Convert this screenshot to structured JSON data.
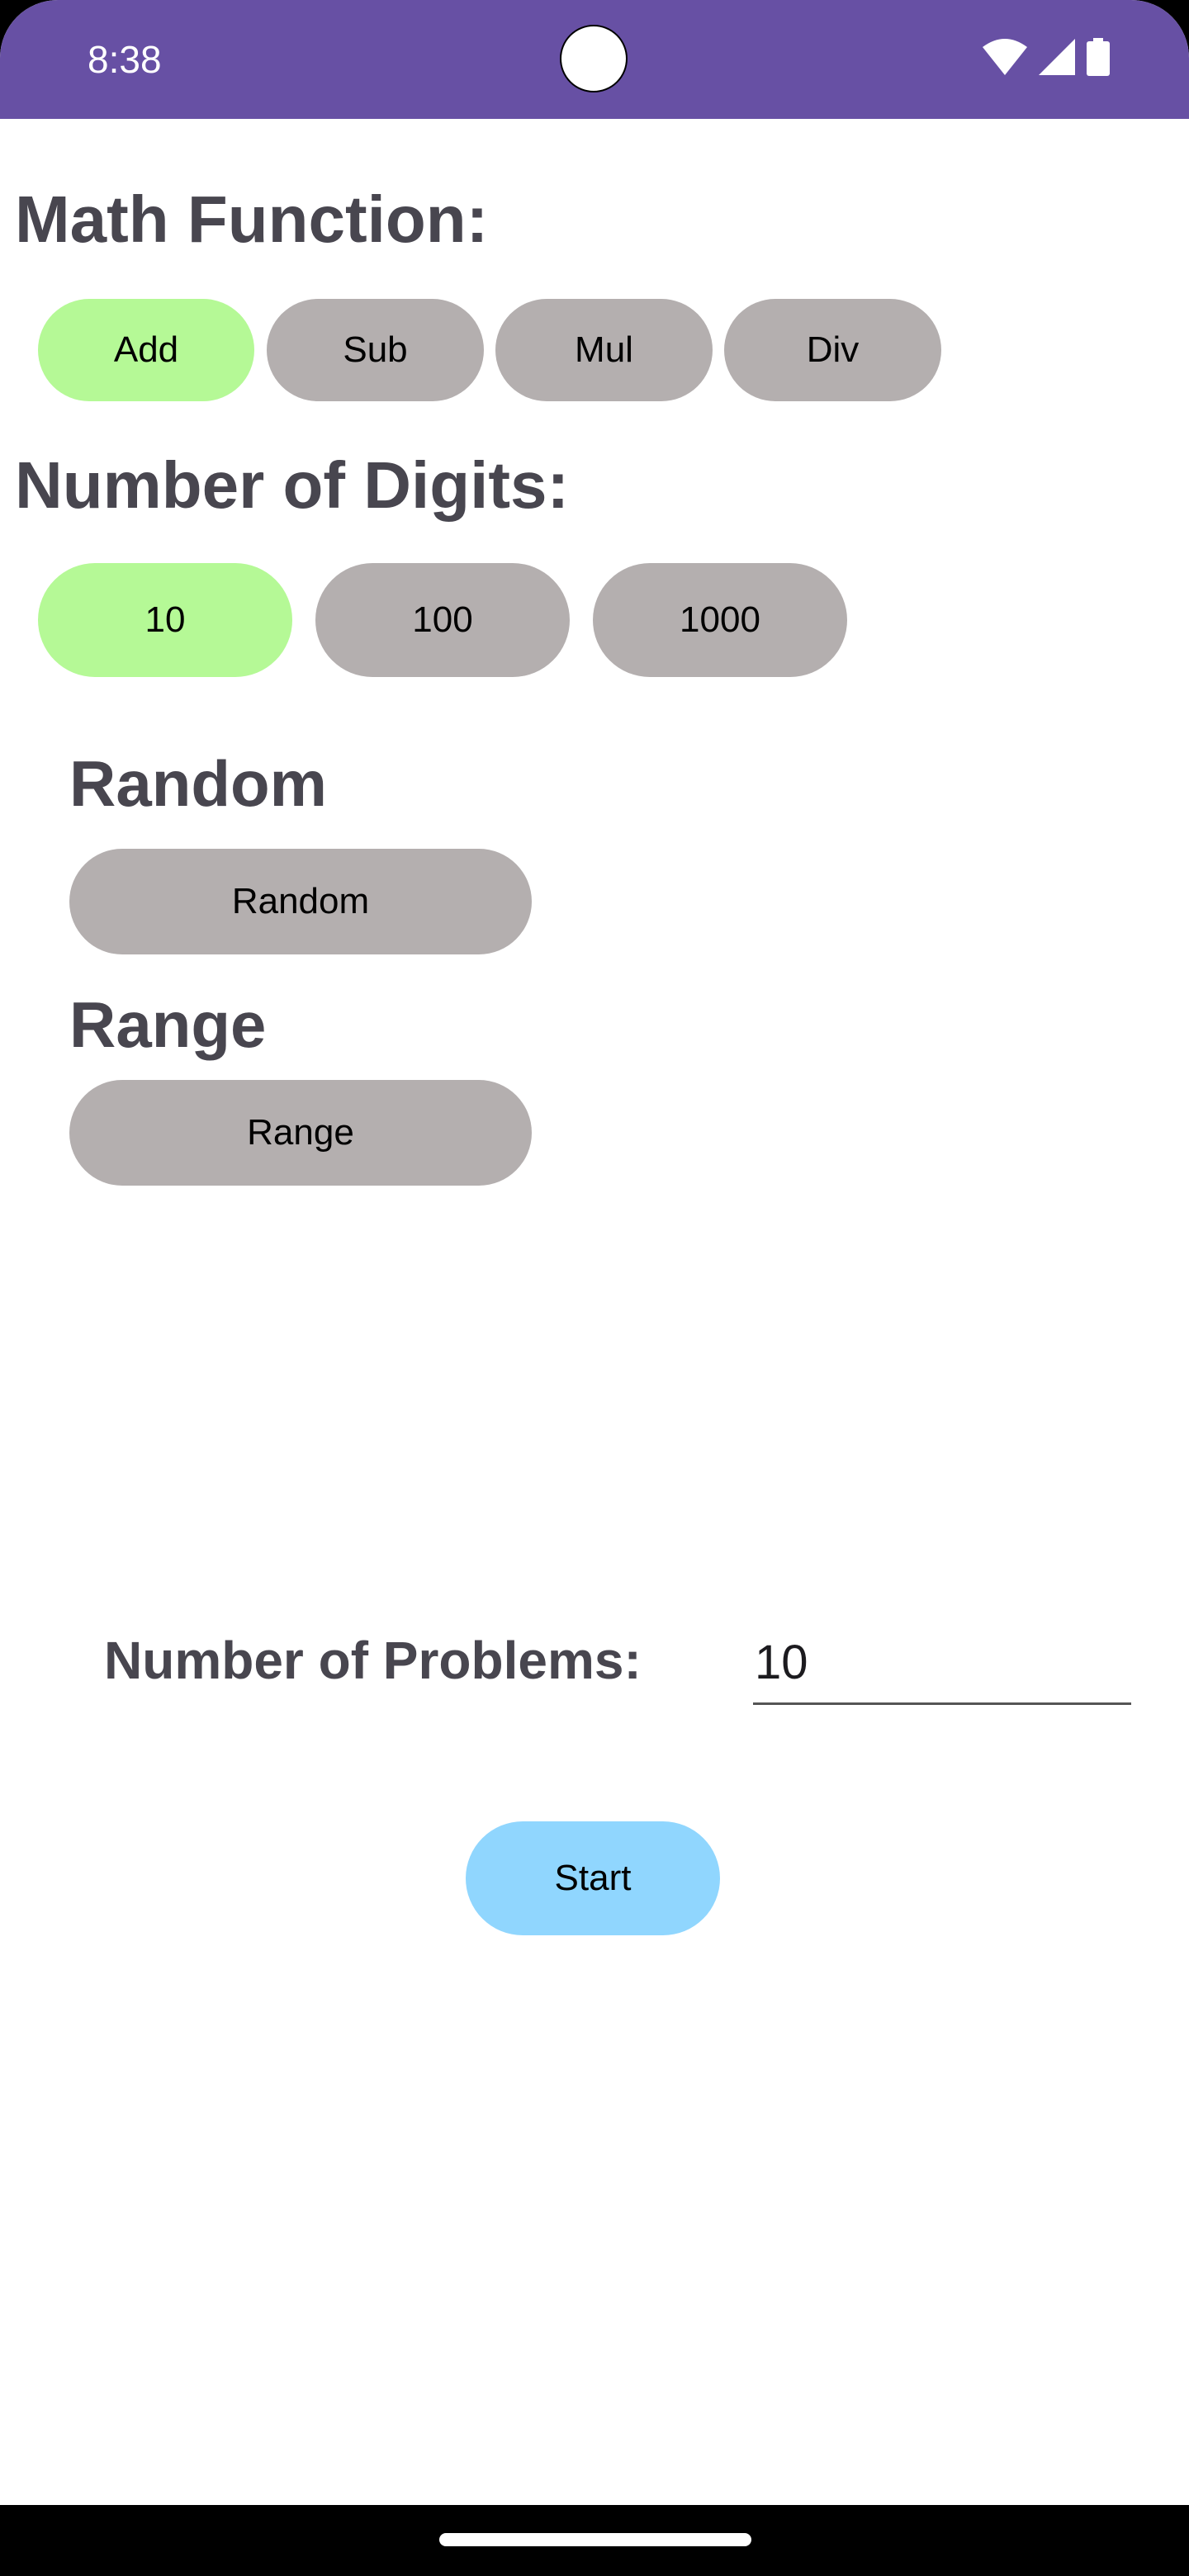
{
  "status_bar": {
    "time": "8:38",
    "icons": [
      "wifi-icon",
      "signal-icon",
      "battery-icon"
    ],
    "color": "#6750a4"
  },
  "math_function": {
    "title": "Math Function:",
    "options": [
      "Add",
      "Sub",
      "Mul",
      "Div"
    ],
    "selected": "Add"
  },
  "digits": {
    "title": "Number of Digits:",
    "options": [
      "10",
      "100",
      "1000"
    ],
    "selected": "10"
  },
  "random": {
    "title": "Random",
    "button_label": "Random"
  },
  "range": {
    "title": "Range",
    "button_label": "Range"
  },
  "problems": {
    "label": "Number of Problems:",
    "value": "10"
  },
  "start_button": {
    "label": "Start"
  },
  "colors": {
    "selected": "#b5f996",
    "unselected": "#b4afaf",
    "start": "#90d6fe",
    "title_text": "#48464f"
  }
}
